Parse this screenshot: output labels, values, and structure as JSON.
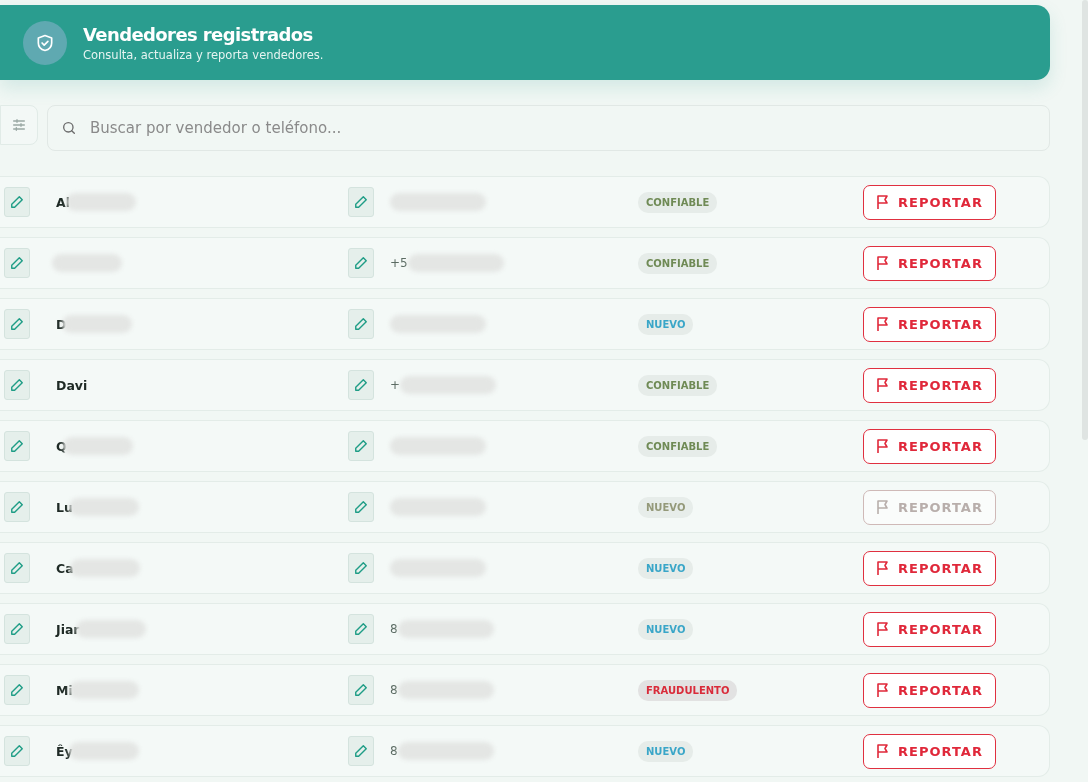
{
  "header": {
    "title": "Vendedores registrados",
    "subtitle": "Consulta, actualiza y reporta vendedores."
  },
  "search": {
    "placeholder": "Buscar por vendedor o teléfono..."
  },
  "rows": [
    {
      "name": "Al",
      "name_redacted": true,
      "phone": "",
      "phone_redacted": true,
      "status": {
        "kind": "trusted",
        "label": "CONFIABLE"
      },
      "report": {
        "label": "REPORTAR",
        "disabled": false
      }
    },
    {
      "name": "",
      "name_redacted": true,
      "phone": "+5",
      "phone_redacted": true,
      "status": {
        "kind": "trusted",
        "label": "CONFIABLE"
      },
      "report": {
        "label": "REPORTAR",
        "disabled": false
      }
    },
    {
      "name": "D",
      "name_redacted": true,
      "phone": "",
      "phone_redacted": true,
      "status": {
        "kind": "new",
        "label": "NUEVO"
      },
      "report": {
        "label": "REPORTAR",
        "disabled": false
      }
    },
    {
      "name": "Davi",
      "name_redacted": false,
      "phone": "+",
      "phone_redacted": true,
      "status": {
        "kind": "trusted",
        "label": "CONFIABLE"
      },
      "report": {
        "label": "REPORTAR",
        "disabled": false
      }
    },
    {
      "name": "Q",
      "name_redacted": true,
      "phone": "",
      "phone_redacted": true,
      "status": {
        "kind": "trusted",
        "label": "CONFIABLE"
      },
      "report": {
        "label": "REPORTAR",
        "disabled": false
      }
    },
    {
      "name": "Lu",
      "name_redacted": true,
      "phone": "",
      "phone_redacted": true,
      "status": {
        "kind": "new",
        "label": "NUEVO"
      },
      "report": {
        "label": "REPORTAR",
        "disabled": true
      }
    },
    {
      "name": "Ca",
      "name_redacted": true,
      "phone": "",
      "phone_redacted": true,
      "status": {
        "kind": "new",
        "label": "NUEVO"
      },
      "report": {
        "label": "REPORTAR",
        "disabled": false
      }
    },
    {
      "name": "Jiar",
      "name_redacted": true,
      "phone": "8",
      "phone_redacted": true,
      "status": {
        "kind": "new",
        "label": "NUEVO"
      },
      "report": {
        "label": "REPORTAR",
        "disabled": false
      }
    },
    {
      "name": "Mi",
      "name_redacted": true,
      "phone": "8",
      "phone_redacted": true,
      "status": {
        "kind": "fraud",
        "label": "FRAUDULENTO"
      },
      "report": {
        "label": "REPORTAR",
        "disabled": false
      }
    },
    {
      "name": "Êy",
      "name_redacted": true,
      "phone": "8",
      "phone_redacted": true,
      "status": {
        "kind": "new",
        "label": "NUEVO"
      },
      "report": {
        "label": "REPORTAR",
        "disabled": false
      }
    }
  ]
}
